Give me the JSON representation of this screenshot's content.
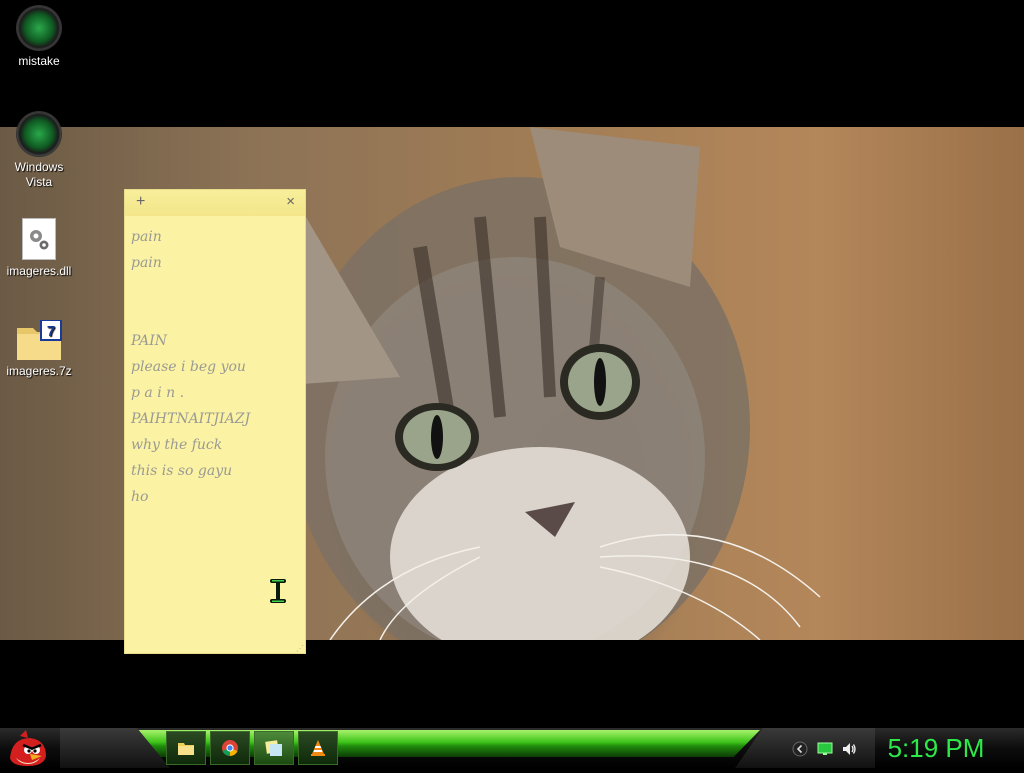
{
  "desktop": {
    "icons": [
      {
        "label": "mistake",
        "icon": "green-orb-icon"
      },
      {
        "label": "Windows Vista",
        "icon": "green-orb-icon"
      },
      {
        "label": "imageres.dll",
        "icon": "dll-file-icon"
      },
      {
        "label": "imageres.7z",
        "icon": "7z-archive-folder-icon"
      }
    ]
  },
  "sticky_note": {
    "add_symbol": "+",
    "close_symbol": "×",
    "lines": [
      "pain",
      "pain",
      "",
      "",
      "PAIN",
      "please i beg you",
      "p a i n .",
      "PAIHTNAITJIAZJ",
      "why the fuck",
      "this is so gayu",
      "ho"
    ],
    "background_color": "#fbf3a3",
    "text_color": "#9a9a94"
  },
  "taskbar": {
    "start_icon": "angry-bird-icon",
    "buttons": [
      {
        "icon": "file-explorer-icon"
      },
      {
        "icon": "chrome-icon"
      },
      {
        "icon": "sticky-notes-icon",
        "active": true
      },
      {
        "icon": "vlc-icon"
      }
    ],
    "tray": [
      {
        "icon": "chevron-icon"
      },
      {
        "icon": "monitor-icon"
      },
      {
        "icon": "volume-icon"
      }
    ],
    "clock": "5:19 PM",
    "accent_color": "#2ee84a"
  }
}
